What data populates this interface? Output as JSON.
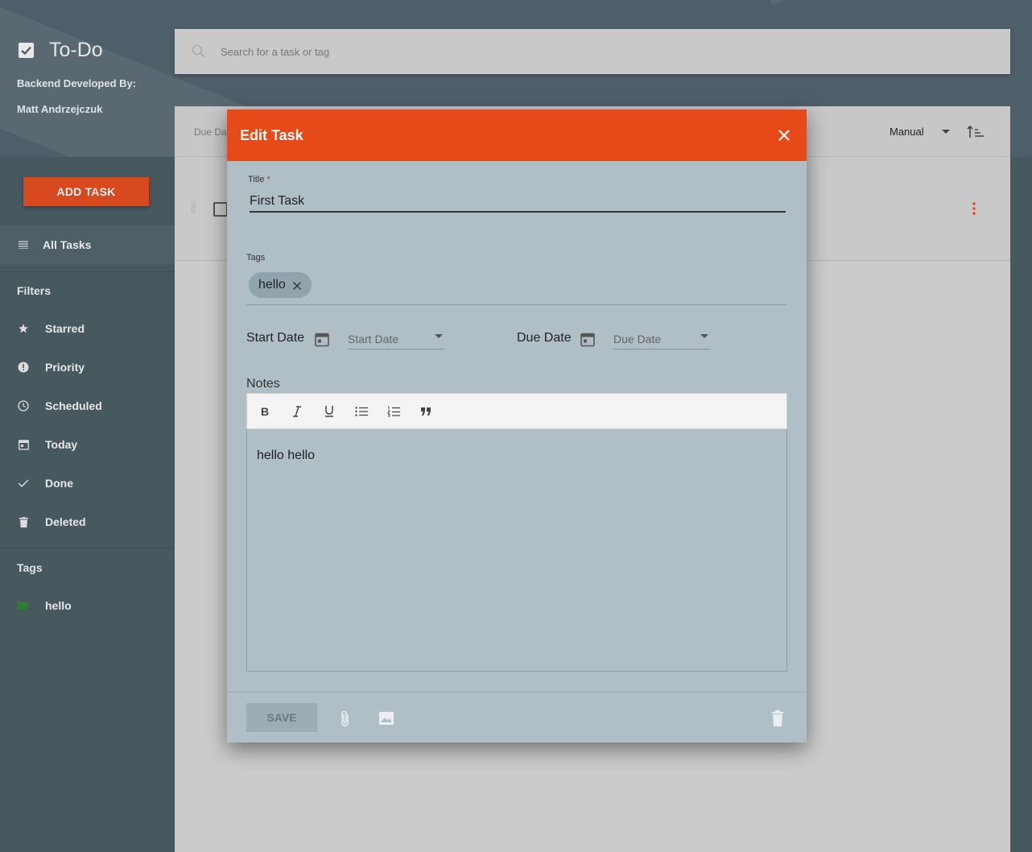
{
  "app": {
    "title": "To-Do",
    "credit_line1": "Backend Developed By:",
    "credit_line2": "Matt Andrzejczuk"
  },
  "search": {
    "placeholder": "Search for a task or tag"
  },
  "sidebar": {
    "add_task_label": "ADD TASK",
    "all_tasks_label": "All Tasks",
    "filters_heading": "Filters",
    "filters": [
      {
        "label": "Starred",
        "icon": "star-icon"
      },
      {
        "label": "Priority",
        "icon": "priority-icon"
      },
      {
        "label": "Scheduled",
        "icon": "clock-icon"
      },
      {
        "label": "Today",
        "icon": "calendar-icon"
      },
      {
        "label": "Done",
        "icon": "check-icon"
      },
      {
        "label": "Deleted",
        "icon": "trash-icon"
      }
    ],
    "tags_heading": "Tags",
    "tags": [
      {
        "label": "hello",
        "color": "#2e7d32"
      }
    ]
  },
  "list": {
    "due_label": "Due Da",
    "sort_label": "Manual"
  },
  "dialog": {
    "title": "Edit Task",
    "title_label": "Title",
    "required_mark": "*",
    "title_value": "First Task",
    "tags_label": "Tags",
    "tags": [
      "hello"
    ],
    "start_date_label": "Start Date",
    "start_date_placeholder": "Start Date",
    "due_date_label": "Due Date",
    "due_date_placeholder": "Due Date",
    "notes_label": "Notes",
    "notes_value": "hello hello",
    "save_label": "SAVE"
  },
  "colors": {
    "accent": "#e64a19",
    "header_bg": "#4f5f69",
    "sidebar_bg": "#47585f",
    "dialog_bg": "#b0bec5"
  }
}
